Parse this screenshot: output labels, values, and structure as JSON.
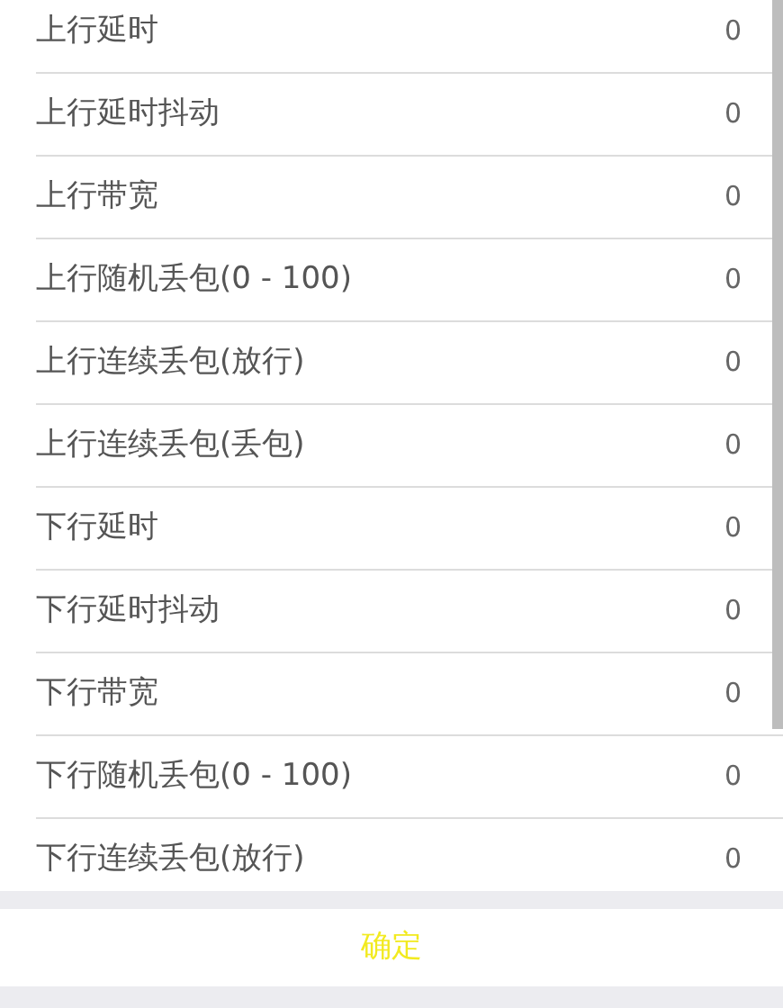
{
  "settings": [
    {
      "label": "上行延时",
      "value": "0"
    },
    {
      "label": "上行延时抖动",
      "value": "0"
    },
    {
      "label": "上行带宽",
      "value": "0"
    },
    {
      "label": "上行随机丢包(0 - 100)",
      "value": "0"
    },
    {
      "label": "上行连续丢包(放行)",
      "value": "0"
    },
    {
      "label": "上行连续丢包(丢包)",
      "value": "0"
    },
    {
      "label": "下行延时",
      "value": "0"
    },
    {
      "label": "下行延时抖动",
      "value": "0"
    },
    {
      "label": "下行带宽",
      "value": "0"
    },
    {
      "label": "下行随机丢包(0 - 100)",
      "value": "0"
    },
    {
      "label": "下行连续丢包(放行)",
      "value": "0"
    }
  ],
  "confirm_button": "确定"
}
